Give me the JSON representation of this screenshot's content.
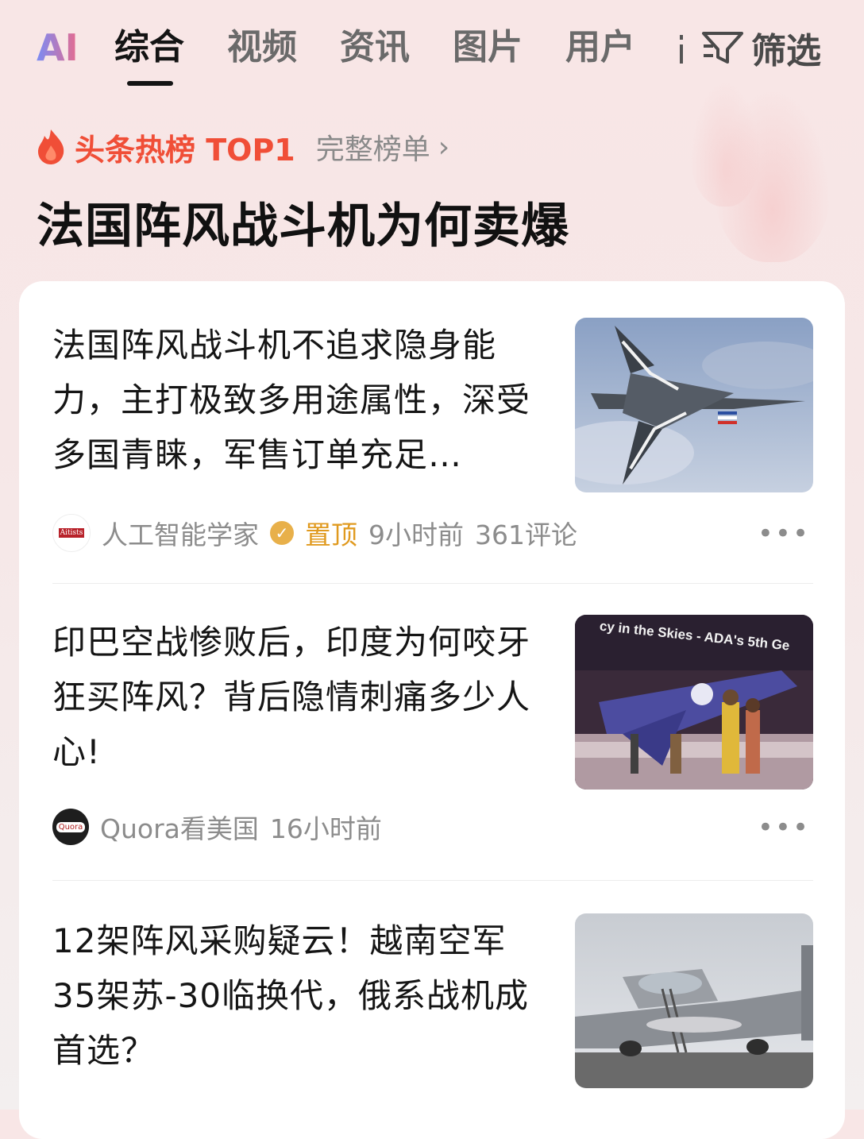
{
  "tabs": [
    {
      "label": "AI"
    },
    {
      "label": "综合"
    },
    {
      "label": "视频"
    },
    {
      "label": "资讯"
    },
    {
      "label": "图片"
    },
    {
      "label": "用户"
    }
  ],
  "filter_label": "筛选",
  "hot": {
    "label": "头条热榜 TOP1",
    "full_list": "完整榜单"
  },
  "headline": "法国阵风战斗机为何卖爆",
  "articles": [
    {
      "title": "法国阵风战斗机不追求隐身能力，主打极致多用途属性，深受多国青睐，军售订单充足…",
      "author": "人工智能学家",
      "avatar_text": "Aitists",
      "pinned": "置顶",
      "time": "9小时前",
      "comments": "361评论"
    },
    {
      "title": "印巴空战惨败后，印度为何咬牙狂买阵风？背后隐情刺痛多少人心!",
      "author": "Quora看美国",
      "avatar_text": "Quora",
      "time": "16小时前",
      "thumb_banner": "cy in the Skies - ADA's 5th Ge"
    },
    {
      "title": "12架阵风采购疑云！越南空军35架苏-30临换代，俄系战机成首选？"
    }
  ],
  "colors": {
    "hot_red": "#f04e37",
    "pinned_gold": "#e09a1f",
    "muted_gray": "#8c8c8c"
  }
}
